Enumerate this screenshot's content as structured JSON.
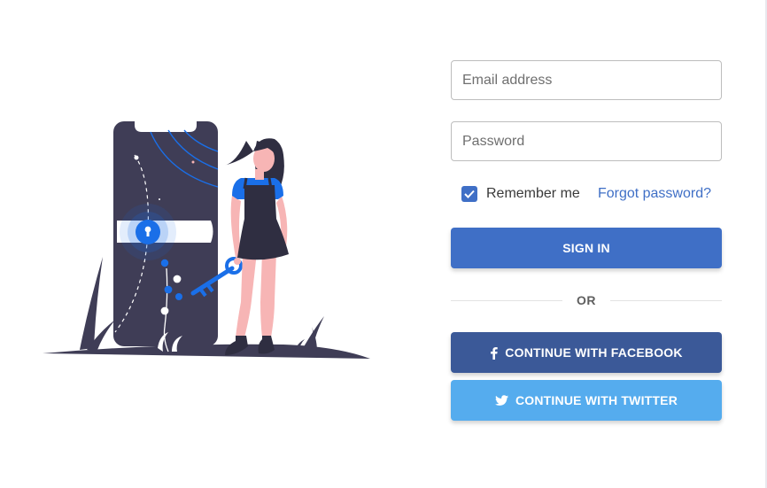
{
  "form": {
    "email_placeholder": "Email address",
    "password_placeholder": "Password",
    "remember_label": "Remember me",
    "remember_checked": true,
    "forgot_label": "Forgot password?",
    "signin_label": "SIGN IN",
    "divider_label": "OR",
    "facebook_label": "CONTINUE WITH FACEBOOK",
    "twitter_label": "CONTINUE WITH TWITTER"
  },
  "icons": {
    "checkbox": "check-icon",
    "facebook": "facebook-icon",
    "twitter": "twitter-icon",
    "illustration_lock": "keyhole-icon",
    "illustration_key": "key-icon"
  },
  "colors": {
    "primary": "#3f6fc6",
    "facebook": "#3b5998",
    "twitter": "#55acee",
    "illustration_dark": "#3f3d56",
    "illustration_accent": "#1a6fe8",
    "skin": "#f7b5b5"
  }
}
